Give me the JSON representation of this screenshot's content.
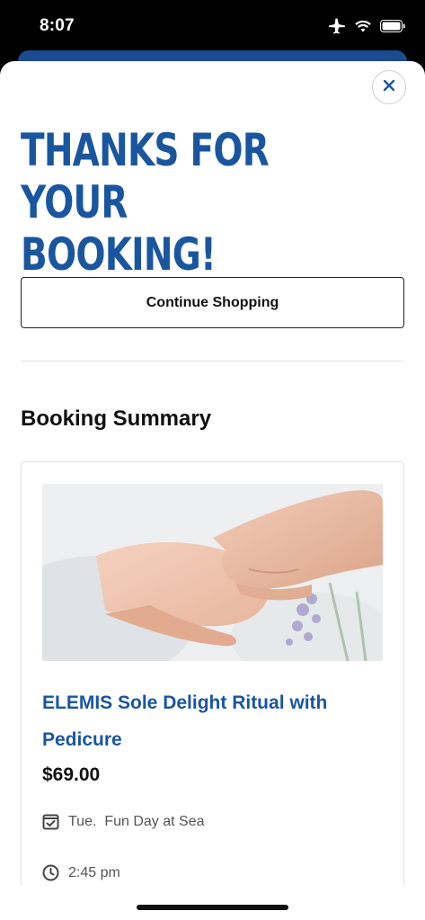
{
  "status_bar": {
    "time": "8:07",
    "icons": [
      "airplane-icon",
      "wifi-icon",
      "battery-icon"
    ]
  },
  "modal": {
    "close_icon": "close-icon",
    "headline": "THANKS FOR\nYOUR BOOKING!",
    "continue_label": "Continue Shopping",
    "summary_title": "Booking Summary"
  },
  "booking": {
    "service_name": "ELEMIS Sole Delight Ritual with Pedicure",
    "price": "$69.00",
    "date_label": "Tue.  Fun Day at Sea",
    "time_label": "2:45 pm"
  },
  "colors": {
    "brand_blue": "#1a56a0",
    "text_dark": "#111111",
    "text_muted": "#555555"
  }
}
